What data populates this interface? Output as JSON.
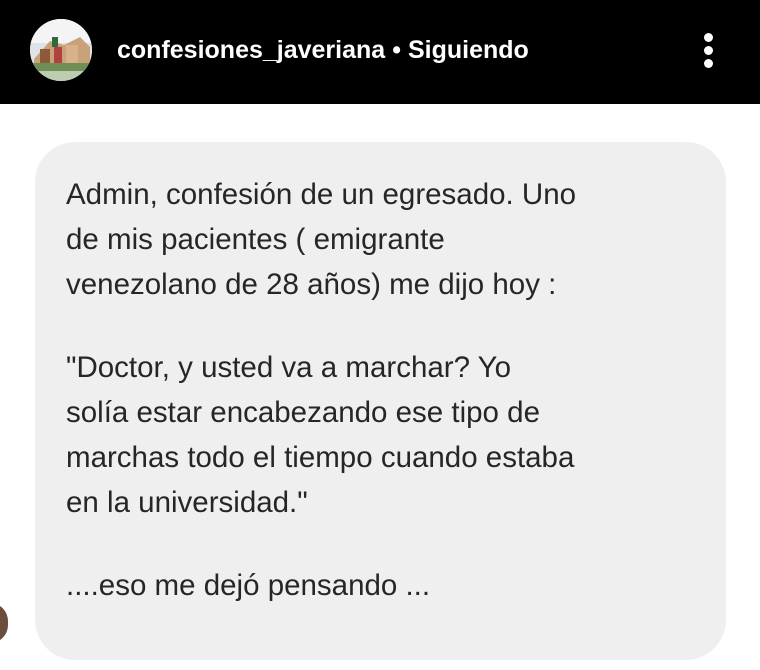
{
  "header": {
    "username": "confesiones_javeriana",
    "separator": "•",
    "following_label": "Siguiendo",
    "avatar_icon": "campus-building-avatar-icon",
    "more_icon": "vertical-ellipsis-icon"
  },
  "message": {
    "paragraphs": [
      "Admin, confesión de un egresado. Uno\nde mis pacientes ( emigrante\nvenezolano de 28 años) me dijo hoy :",
      "\"Doctor, y usted va a marchar? Yo\nsolía estar encabezando ese tipo de\nmarchas todo el tiempo cuando estaba\nen la universidad.\"",
      "....eso me dejó pensando ..."
    ]
  },
  "colors": {
    "topbar_bg": "#000000",
    "bubble_bg": "#efefef",
    "text": "#262626",
    "header_text": "#ffffff"
  }
}
